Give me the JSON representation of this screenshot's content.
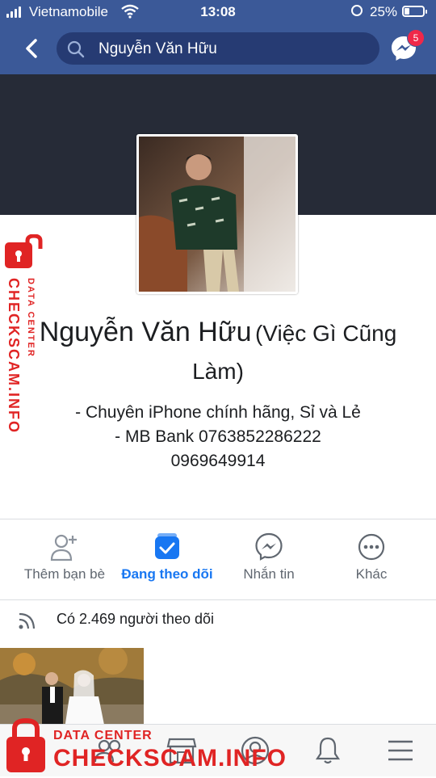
{
  "status_bar": {
    "carrier": "Vietnamobile",
    "time": "13:08",
    "battery_percent": "25%",
    "battery_level": 0.25
  },
  "nav": {
    "search_value": "Nguyễn Văn Hữu",
    "messenger_badge": "5"
  },
  "profile": {
    "name": "Nguyễn Văn Hữu",
    "alternate_name": "(Việc Gì Cũng Làm)",
    "bio_lines": [
      "- Chuyên  iPhone chính hãng, Sỉ và Lẻ",
      "- MB Bank 0763852286222",
      "0969649914"
    ]
  },
  "actions": [
    {
      "label": "Thêm bạn bè",
      "icon": "add-friend-icon"
    },
    {
      "label": "Đang theo dõi",
      "icon": "following-icon",
      "active": true
    },
    {
      "label": "Nhắn tin",
      "icon": "messenger-icon"
    },
    {
      "label": "Khác",
      "icon": "more-icon"
    }
  ],
  "followers_text": "Có 2.469 người theo dõi",
  "tabbar": [
    "news-feed-icon",
    "friends-icon",
    "marketplace-icon",
    "profile-icon",
    "notifications-icon",
    "menu-icon"
  ],
  "watermark": {
    "side_main": "CHECKSCAM.INFO",
    "side_sub": "DATA CENTER",
    "bottom_sub": "DATA CENTER",
    "bottom_main": "CHECKSCAM.INFO"
  },
  "colors": {
    "brand": "#3b5998",
    "accent": "#1877f2",
    "watermark": "#e02424"
  }
}
